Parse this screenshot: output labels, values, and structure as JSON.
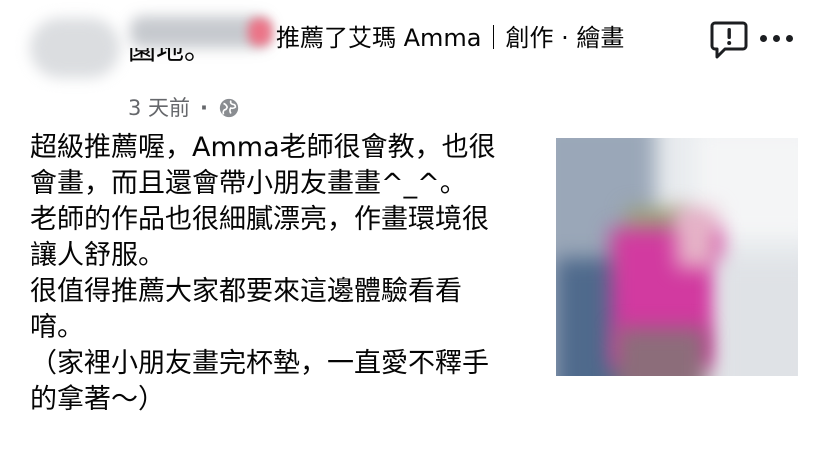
{
  "post": {
    "header_text": "推薦了艾瑪 Amma｜創作 · 繪畫",
    "header_cut_text": "園地。",
    "time": "3 天前",
    "time_separator": "·",
    "privacy_icon": "globe-icon",
    "report_icon": "report-icon",
    "more_icon": "more-dots-icon",
    "body_lines": [
      "超級推薦喔，Amma老師很會教，也很",
      "會畫，而且還會帶小朋友畫畫^_^。",
      "老師的作品也很細膩漂亮，作畫環境很",
      "讓人舒服。",
      "很值得推薦大家都要來這邊體驗看看",
      "唷。",
      "（家裡小朋友畫完杯墊，一直愛不釋手",
      "的拿著～）"
    ]
  },
  "colors": {
    "text": "#050505",
    "meta": "#65676b",
    "accent_pink": "#f1657b",
    "photo_magenta": "#d23aa0"
  }
}
